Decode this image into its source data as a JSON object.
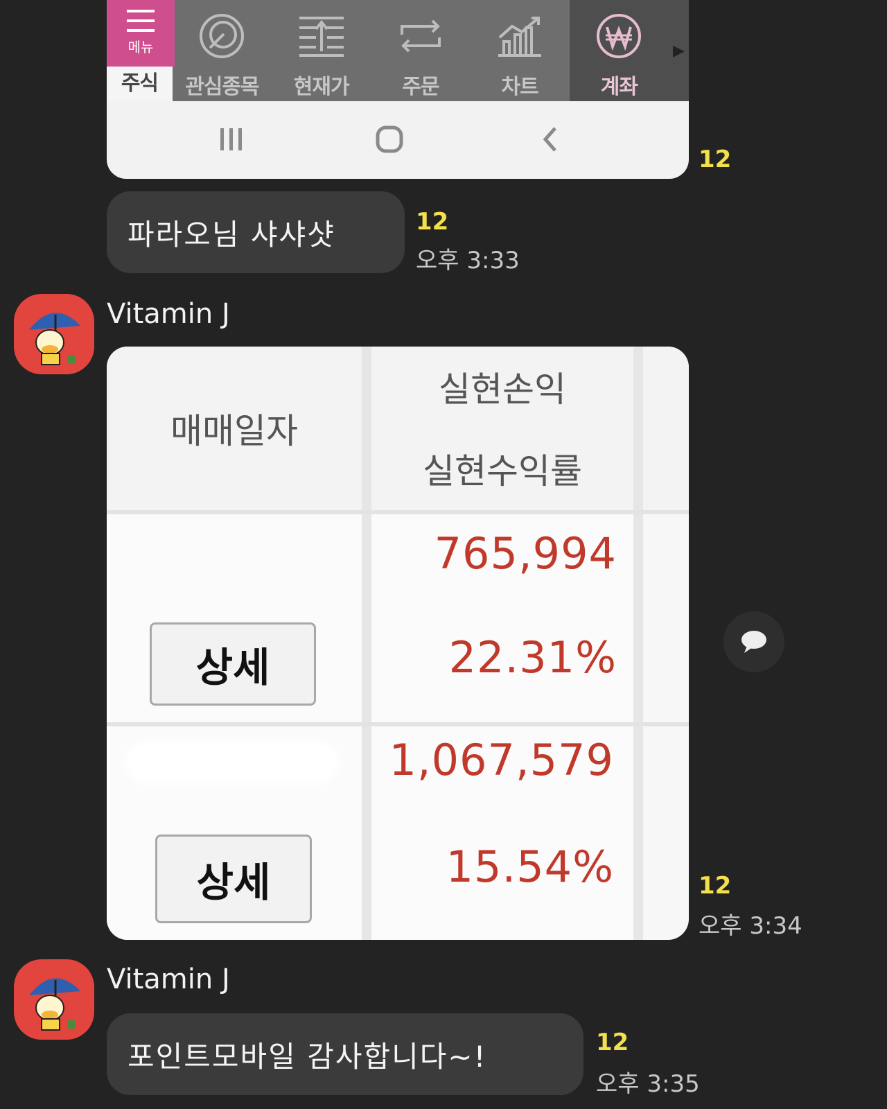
{
  "toolbar": {
    "menu_text": "메뉴",
    "items": [
      {
        "label": "주식",
        "icon": "menu-icon"
      },
      {
        "label": "관심종목",
        "icon": "target-icon"
      },
      {
        "label": "현재가",
        "icon": "price-icon"
      },
      {
        "label": "주문",
        "icon": "exchange-icon"
      },
      {
        "label": "차트",
        "icon": "chart-icon"
      },
      {
        "label": "계좌",
        "icon": "won-icon"
      }
    ]
  },
  "messages": [
    {
      "unread": "12"
    },
    {
      "text": "파라오님 샤샤샷",
      "unread": "12",
      "time": "오후 3:33"
    },
    {
      "sender": "Vitamin J",
      "unread": "12",
      "time": "오후 3:34"
    },
    {
      "sender": "Vitamin J",
      "text": "포인트모바일 감사합니다~!",
      "unread": "12",
      "time": "오후 3:35"
    }
  ],
  "table": {
    "col_date": "매매일자",
    "col_profit": "실현손익",
    "col_rate": "실현수익률",
    "detail_label": "상세",
    "rows": [
      {
        "profit": "765,994",
        "rate": "22.31%"
      },
      {
        "profit": "1,067,579",
        "rate": "15.54%"
      }
    ]
  },
  "colors": {
    "background": "#232323",
    "bubble": "#3b3b3b",
    "unread": "#f3e04a",
    "profit_red": "#c0392b",
    "menu_pink": "#cf4f8e"
  }
}
